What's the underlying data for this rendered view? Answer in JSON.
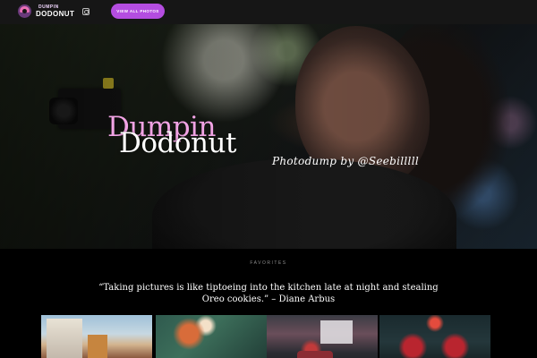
{
  "header": {
    "logo_small": "DUMPIN",
    "logo_big": "DODONUT",
    "view_button": "VIEW ALL PHOTOS"
  },
  "hero": {
    "title_line1": "Dumpin",
    "title_line2": "Dodonut",
    "subtitle": "Photodump by @Seebilllll"
  },
  "favorites": {
    "label": "FAVORITES",
    "quote": "“Taking pictures is like tiptoeing into the kitchen late at night and stealing Oreo cookies.” – Diane Arbus"
  },
  "colors": {
    "accent": "#b44de0",
    "title_pink": "#f1a3e4",
    "background": "#000000"
  },
  "icons": [
    "donut-logo-icon",
    "instagram-icon"
  ]
}
